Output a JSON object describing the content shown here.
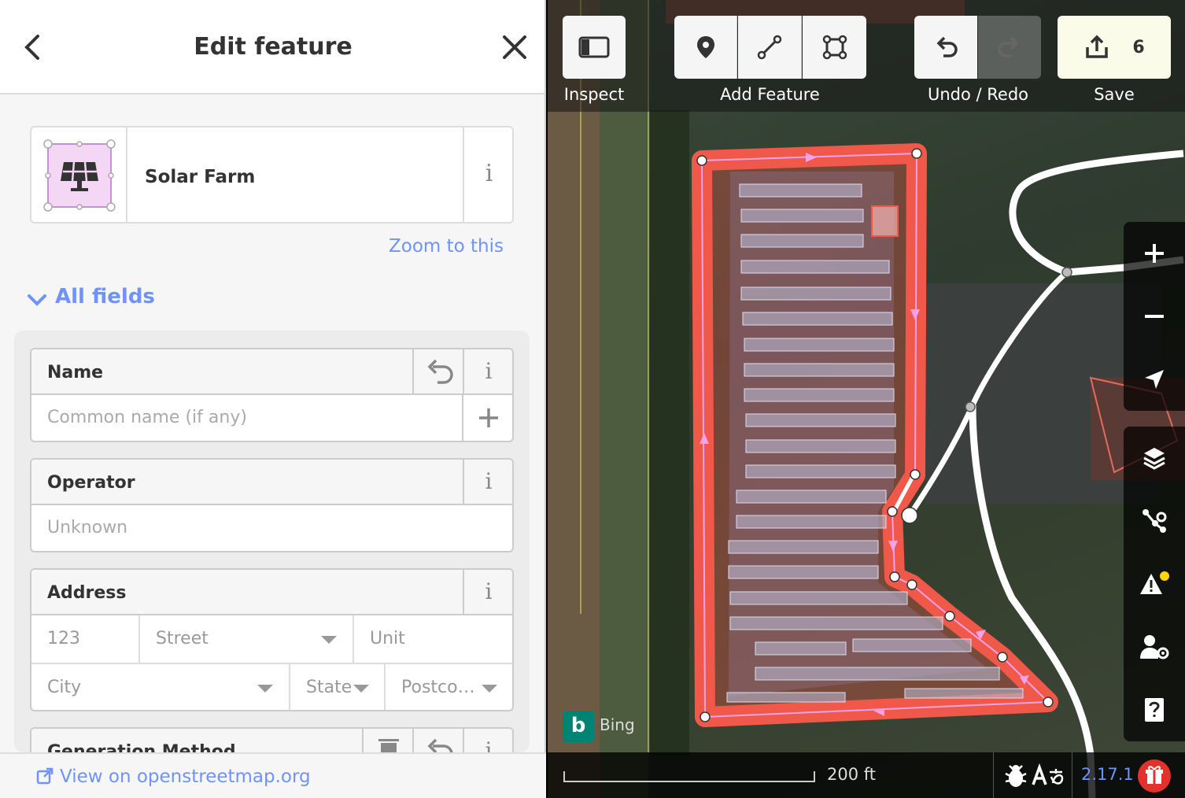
{
  "sidebar": {
    "header": {
      "title": "Edit feature"
    },
    "preset": {
      "name": "Solar Farm",
      "info_label": "i"
    },
    "zoom_to_this": "Zoom to this",
    "all_fields": "All fields",
    "fields": {
      "name": {
        "label": "Name",
        "placeholder": "Common name (if any)",
        "info_label": "i"
      },
      "operator": {
        "label": "Operator",
        "placeholder": "Unknown",
        "info_label": "i"
      },
      "address": {
        "label": "Address",
        "info_label": "i",
        "housenumber_placeholder": "123",
        "street_placeholder": "Street",
        "unit_placeholder": "Unit",
        "city_placeholder": "City",
        "state_placeholder": "State",
        "postcode_placeholder": "Postco…"
      },
      "generation_method": {
        "label": "Generation Method",
        "info_label": "i"
      }
    },
    "footer": {
      "view_on_osm": "View on openstreetmap.org"
    }
  },
  "toolbar": {
    "inspect_label": "Inspect",
    "add_feature_label": "Add Feature",
    "undo_redo_label": "Undo / Redo",
    "save_label": "Save",
    "save_count": "6"
  },
  "map": {
    "imagery_source": "Bing",
    "scale_label": "200 ft",
    "version": "2.17.1",
    "issues_badge_color": "#ffd700",
    "selection_color": "#f0584a",
    "accent_color": "#7092ff"
  },
  "icons": {
    "back": "chevron-left-icon",
    "close": "close-icon",
    "preset": "solar-panel-icon",
    "inspect": "sidebar-toggle-icon",
    "point": "point-marker-icon",
    "line": "line-icon",
    "area": "area-icon",
    "undo": "undo-icon",
    "redo": "redo-icon",
    "save": "upload-icon",
    "zoom_in": "plus-icon",
    "zoom_out": "minus-icon",
    "geolocate": "location-arrow-icon",
    "layers": "layers-icon",
    "map_data": "map-data-icon",
    "issues": "warning-icon",
    "preferences": "user-gear-icon",
    "help": "help-icon"
  }
}
